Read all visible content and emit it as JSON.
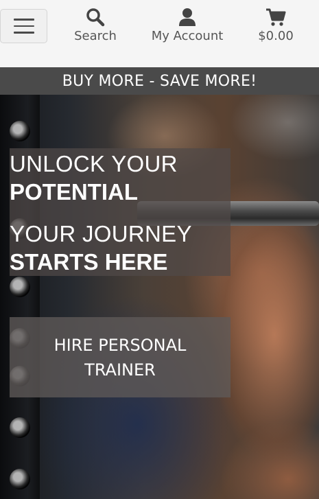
{
  "nav": {
    "menu_icon": "hamburger-icon",
    "search": {
      "label": "Search",
      "icon": "search-icon"
    },
    "account": {
      "label": "My Account",
      "icon": "user-icon"
    },
    "cart": {
      "label": "$0.00",
      "icon": "cart-icon"
    }
  },
  "promo": {
    "text": "BUY MORE - SAVE MORE!"
  },
  "hero": {
    "line1": "UNLOCK YOUR",
    "line2": "POTENTIAL",
    "line3": "YOUR JOURNEY",
    "line4": "STARTS HERE",
    "cta_label": "HIRE PERSONAL TRAINER"
  },
  "colors": {
    "topbar_bg": "#f5f5f5",
    "promo_bg": "#4a4a4a",
    "text_on_dark": "#ffffff",
    "nav_text": "#555555"
  }
}
